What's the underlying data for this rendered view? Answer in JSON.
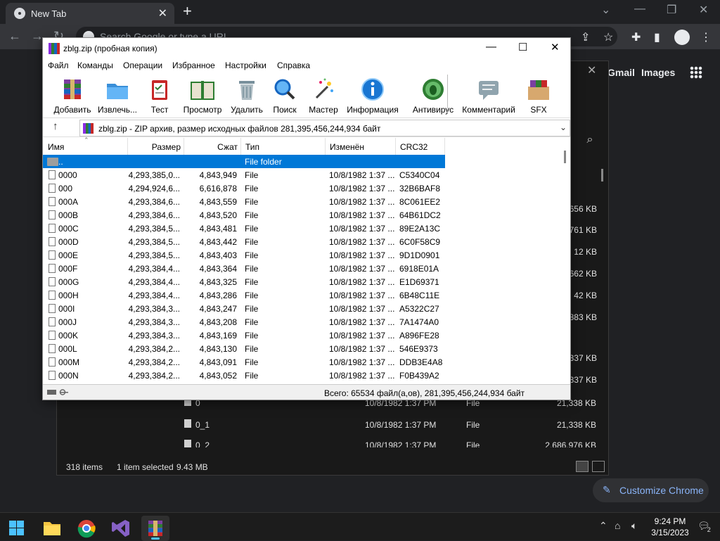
{
  "chrome": {
    "tab_title": "New Tab",
    "omnibox_placeholder": "Search Google or type a URL",
    "header_links": [
      "Gmail",
      "Images"
    ],
    "customize_label": "Customize Chrome"
  },
  "explorer": {
    "sizes_right": [
      "656 KB",
      "761 KB",
      "12 KB",
      "662 KB",
      "42 KB",
      "883 KB",
      "337 KB",
      "337 KB"
    ],
    "rows": [
      {
        "name": "0",
        "date": "10/8/1982 1:37 PM",
        "type": "File",
        "size": "21,338 KB"
      },
      {
        "name": "0_1",
        "date": "10/8/1982 1:37 PM",
        "type": "File",
        "size": "21,338 KB"
      },
      {
        "name": "0_2",
        "date": "10/8/1982 1:37 PM",
        "type": "File",
        "size": "2,686,976 KB"
      }
    ],
    "status": {
      "items": "318 items",
      "selected": "1 item selected",
      "size": "9.43 MB"
    }
  },
  "winrar": {
    "title": "zblg.zip (пробная копия)",
    "menu": [
      "Файл",
      "Команды",
      "Операции",
      "Избранное",
      "Настройки",
      "Справка"
    ],
    "tools": [
      {
        "label": "Добавить",
        "icon": "add-archive-icon"
      },
      {
        "label": "Извлечь...",
        "icon": "extract-folder-icon"
      },
      {
        "label": "Тест",
        "icon": "test-clipboard-icon"
      },
      {
        "label": "Просмотр",
        "icon": "view-book-icon"
      },
      {
        "label": "Удалить",
        "icon": "delete-trash-icon"
      },
      {
        "label": "Поиск",
        "icon": "find-magnifier-icon"
      },
      {
        "label": "Мастер",
        "icon": "wizard-wand-icon"
      },
      {
        "label": "Информация",
        "icon": "info-icon"
      },
      {
        "label": "Антивирус",
        "icon": "antivirus-bug-icon"
      },
      {
        "label": "Комментарий",
        "icon": "comment-icon"
      },
      {
        "label": "SFX",
        "icon": "sfx-boxes-icon"
      }
    ],
    "address": "zblg.zip - ZIP архив, размер исходных файлов 281,395,456,244,934 байт",
    "columns": [
      "Имя",
      "Размер",
      "Сжат",
      "Тип",
      "Изменён",
      "CRC32"
    ],
    "parent_row": {
      "name": "..",
      "type": "File folder"
    },
    "files": [
      {
        "name": "0000",
        "size": "4,293,385,0...",
        "packed": "4,843,949",
        "type": "File",
        "modified": "10/8/1982 1:37 ...",
        "crc": "C5340C04"
      },
      {
        "name": "000",
        "size": "4,294,924,6...",
        "packed": "6,616,878",
        "type": "File",
        "modified": "10/8/1982 1:37 ...",
        "crc": "32B6BAF8"
      },
      {
        "name": "000A",
        "size": "4,293,384,6...",
        "packed": "4,843,559",
        "type": "File",
        "modified": "10/8/1982 1:37 ...",
        "crc": "8C061EE2"
      },
      {
        "name": "000B",
        "size": "4,293,384,6...",
        "packed": "4,843,520",
        "type": "File",
        "modified": "10/8/1982 1:37 ...",
        "crc": "64B61DC2"
      },
      {
        "name": "000C",
        "size": "4,293,384,5...",
        "packed": "4,843,481",
        "type": "File",
        "modified": "10/8/1982 1:37 ...",
        "crc": "89E2A13C"
      },
      {
        "name": "000D",
        "size": "4,293,384,5...",
        "packed": "4,843,442",
        "type": "File",
        "modified": "10/8/1982 1:37 ...",
        "crc": "6C0F58C9"
      },
      {
        "name": "000E",
        "size": "4,293,384,5...",
        "packed": "4,843,403",
        "type": "File",
        "modified": "10/8/1982 1:37 ...",
        "crc": "9D1D0901"
      },
      {
        "name": "000F",
        "size": "4,293,384,4...",
        "packed": "4,843,364",
        "type": "File",
        "modified": "10/8/1982 1:37 ...",
        "crc": "6918E01A"
      },
      {
        "name": "000G",
        "size": "4,293,384,4...",
        "packed": "4,843,325",
        "type": "File",
        "modified": "10/8/1982 1:37 ...",
        "crc": "E1D69371"
      },
      {
        "name": "000H",
        "size": "4,293,384,4...",
        "packed": "4,843,286",
        "type": "File",
        "modified": "10/8/1982 1:37 ...",
        "crc": "6B48C11E"
      },
      {
        "name": "000I",
        "size": "4,293,384,3...",
        "packed": "4,843,247",
        "type": "File",
        "modified": "10/8/1982 1:37 ...",
        "crc": "A5322C27"
      },
      {
        "name": "000J",
        "size": "4,293,384,3...",
        "packed": "4,843,208",
        "type": "File",
        "modified": "10/8/1982 1:37 ...",
        "crc": "7A1474A0"
      },
      {
        "name": "000K",
        "size": "4,293,384,3...",
        "packed": "4,843,169",
        "type": "File",
        "modified": "10/8/1982 1:37 ...",
        "crc": "A896FE28"
      },
      {
        "name": "000L",
        "size": "4,293,384,2...",
        "packed": "4,843,130",
        "type": "File",
        "modified": "10/8/1982 1:37 ...",
        "crc": "546E9373"
      },
      {
        "name": "000M",
        "size": "4,293,384,2...",
        "packed": "4,843,091",
        "type": "File",
        "modified": "10/8/1982 1:37 ...",
        "crc": "DDB3E4A8"
      },
      {
        "name": "000N",
        "size": "4,293,384,2...",
        "packed": "4,843,052",
        "type": "File",
        "modified": "10/8/1982 1:37 ...",
        "crc": "F0B439A2"
      }
    ],
    "status": "Всего: 65534 файл(а,ов), 281,395,456,244,934 байт"
  },
  "taskbar": {
    "time": "9:24 PM",
    "date": "3/15/2023",
    "notification_count": "2",
    "accent": "#4cc2ff"
  },
  "colors": {
    "selection": "#0078d7",
    "chrome_link": "#8ab4f8"
  }
}
